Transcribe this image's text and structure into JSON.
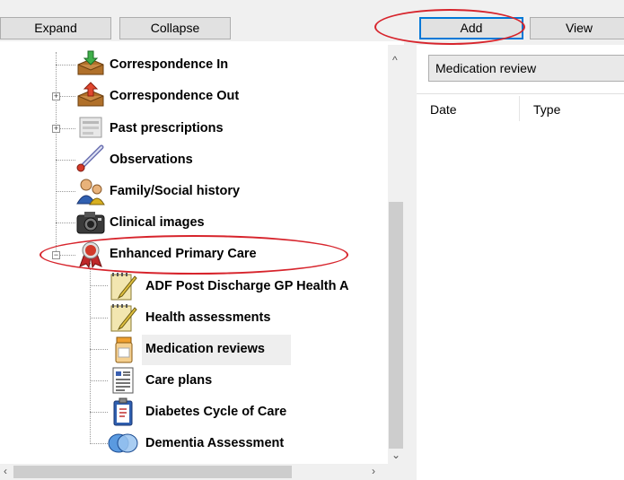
{
  "toolbar": {
    "expand_label": "Expand",
    "collapse_label": "Collapse",
    "add_label": "Add",
    "view_label": "View"
  },
  "tree": {
    "items": [
      {
        "label": "Correspondence In",
        "icon": "correspondence-in-icon"
      },
      {
        "label": "Correspondence Out",
        "icon": "correspondence-out-icon"
      },
      {
        "label": "Past prescriptions",
        "icon": "prescriptions-icon"
      },
      {
        "label": "Observations",
        "icon": "thermometer-icon"
      },
      {
        "label": "Family/Social history",
        "icon": "family-icon"
      },
      {
        "label": "Clinical images",
        "icon": "camera-icon"
      },
      {
        "label": "Enhanced Primary Care",
        "icon": "ribbon-icon"
      }
    ],
    "children": [
      {
        "label": "ADF Post Discharge GP Health A",
        "icon": "notepad-icon"
      },
      {
        "label": "Health assessments",
        "icon": "notepad-icon"
      },
      {
        "label": "Medication reviews",
        "icon": "pill-bottle-icon"
      },
      {
        "label": "Care plans",
        "icon": "document-icon"
      },
      {
        "label": "Diabetes Cycle of Care",
        "icon": "clipboard-icon"
      },
      {
        "label": "Dementia Assessment",
        "icon": "brain-icon"
      }
    ]
  },
  "right_panel": {
    "dropdown_value": "Medication review",
    "columns": [
      "Date",
      "Type"
    ]
  },
  "colors": {
    "highlight_red": "#d7242c",
    "selected_bg": "#eeeeee",
    "button_bg": "#e1e1e1",
    "add_border": "#0078d7"
  }
}
